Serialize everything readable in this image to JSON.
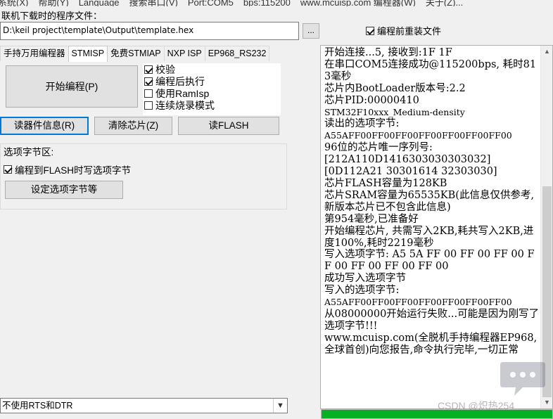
{
  "menu": [
    "系统(X)",
    "帮助(Y)",
    "Language",
    "搜索串口(V)",
    "Port:COM5",
    "bps:115200",
    "www.mcuisp.com 编程器(W)",
    "关于(Z)..."
  ],
  "file": {
    "label": "联机下载时的程序文件：",
    "path": "D:\\keil project\\template\\Output\\template.hex",
    "browse": "...",
    "reload_label": "编程前重装文件",
    "reload_checked": true
  },
  "tabs": [
    "手持万用编程器",
    "STMISP",
    "免费STMIAP",
    "NXP ISP",
    "EP968_RS232"
  ],
  "active_tab": 1,
  "program_button": "开始编程(P)",
  "options": [
    {
      "label": "校验",
      "checked": true
    },
    {
      "label": "编程后执行",
      "checked": true
    },
    {
      "label": "使用RamIsp",
      "checked": false
    },
    {
      "label": "连续烧录模式",
      "checked": false
    }
  ],
  "buttons": {
    "read_info": "读器件信息(R)",
    "erase": "清除芯片(Z)",
    "read_flash": "读FLASH"
  },
  "option_bytes": {
    "title": "选项字节区:",
    "write_label": "编程到FLASH时写选项字节",
    "write_checked": true,
    "set_button": "设定选项字节等"
  },
  "rts_dtr": {
    "value": "不使用RTS和DTR"
  },
  "log": [
    "开始连接...5, 接收到:1F 1F",
    "在串口COM5连接成功@115200bps, 耗时813毫秒",
    "芯片内BootLoader版本号:2.2",
    "芯片PID:00000410",
    "STM32F10xxx_Medium-density",
    "读出的选项字节:",
    "A55AFF00FF00FF00FF00FF00FF00FF00",
    "96位的芯片唯一序列号:",
    "[212A110D1416303030303032]",
    "[0D112A21 30301614 32303030]",
    "芯片FLASH容量为128KB",
    "芯片SRAM容量为65535KB(此信息仅供参考,新版本芯片已不包含此信息)",
    "第954毫秒,已准备好",
    "开始编程芯片, 共需写入2KB,耗共写入2KB,进度100%,耗时2219毫秒",
    "写入选项字节: A5 5A FF 00 FF 00 FF 00 FF 00 FF 00 FF 00 FF 00",
    "成功写入选项字节",
    "写入的选项字节:",
    "A55AFF00FF00FF00FF00FF00FF00FF00",
    "从08000000开始运行失败...可能是因为刚写了选项字节!!!",
    "www.mcuisp.com(全脱机手持编程器EP968,全球首创)向您报告,命令执行完毕,一切正常"
  ],
  "progress": 1.0,
  "colors": {
    "progress_fill": "#06b025",
    "button_face": "#e1e1e1",
    "focus_border": "#0078d7"
  },
  "watermark": "CSDN @炽热254",
  "icons": {
    "chat": "chat-bubble-icon",
    "dropdown": "chevron-down-icon"
  }
}
